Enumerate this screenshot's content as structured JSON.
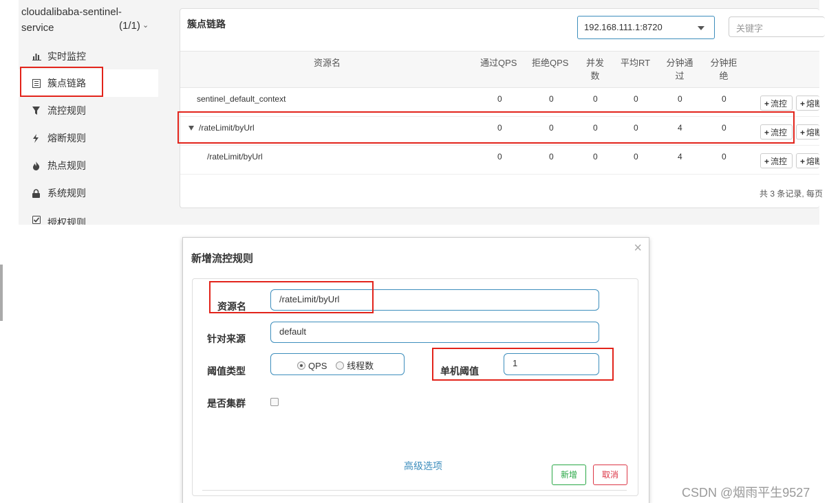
{
  "sidebar": {
    "app_name": "cloudalibaba-sentinel-service",
    "app_count": "(1/1)",
    "items": [
      {
        "label": "实时监控",
        "icon": "bar-chart-icon"
      },
      {
        "label": "簇点链路",
        "icon": "list-icon"
      },
      {
        "label": "流控规则",
        "icon": "filter-icon"
      },
      {
        "label": "熔断规则",
        "icon": "lightning-icon"
      },
      {
        "label": "热点规则",
        "icon": "fire-icon"
      },
      {
        "label": "系统规则",
        "icon": "lock-icon"
      },
      {
        "label": "授权规则",
        "icon": "check-square-icon"
      }
    ]
  },
  "panel": {
    "title": "簇点链路",
    "machine_select": "192.168.111.1:8720",
    "keyword_placeholder": "关键字",
    "columns": [
      "资源名",
      "通过QPS",
      "拒绝QPS",
      "并发数",
      "平均RT",
      "分钟通过",
      "分钟拒绝"
    ],
    "rows": [
      {
        "name": "sentinel_default_context",
        "pass_qps": "0",
        "block_qps": "0",
        "concurrency": "0",
        "avg_rt": "0",
        "min_pass": "0",
        "min_block": "0"
      },
      {
        "name": "/rateLimit/byUrl",
        "pass_qps": "0",
        "block_qps": "0",
        "concurrency": "0",
        "avg_rt": "0",
        "min_pass": "4",
        "min_block": "0"
      },
      {
        "name": "/rateLimit/byUrl",
        "pass_qps": "0",
        "block_qps": "0",
        "concurrency": "0",
        "avg_rt": "0",
        "min_pass": "4",
        "min_block": "0"
      }
    ],
    "flow_btn": "流控",
    "degrade_btn": "熔断",
    "footer": "共 3 条记录, 每页"
  },
  "modal": {
    "title": "新增流控规则",
    "close": "×",
    "resource_label": "资源名",
    "resource_value": "/rateLimit/byUrl",
    "limit_app_label": "针对来源",
    "limit_app_value": "default",
    "grade_label": "阈值类型",
    "grade_qps": "QPS",
    "grade_thread": "线程数",
    "count_label": "单机阈值",
    "count_value": "1",
    "cluster_label": "是否集群",
    "advanced": "高级选项",
    "add_btn": "新增",
    "cancel_btn": "取消"
  },
  "watermark": "CSDN @烟雨平生9527",
  "colors": {
    "accent": "#3c8dbc",
    "highlight": "#e2231a",
    "add": "#28a745",
    "cancel": "#dc3545"
  }
}
